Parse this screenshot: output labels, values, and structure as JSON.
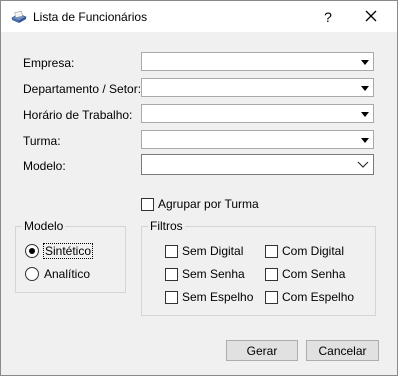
{
  "window": {
    "title": "Lista de Funcionários",
    "help_glyph": "?",
    "close_icon": "close-icon",
    "app_icon": "report-icon"
  },
  "fields": {
    "empresa": {
      "label": "Empresa:",
      "value": ""
    },
    "departamento": {
      "label": "Departamento / Setor:",
      "value": ""
    },
    "horario": {
      "label": "Horário de Trabalho:",
      "value": ""
    },
    "turma": {
      "label": "Turma:",
      "value": ""
    },
    "modelo": {
      "label": "Modelo:",
      "value": ""
    }
  },
  "agrupar": {
    "label": "Agrupar por Turma",
    "checked": false
  },
  "modelo_group": {
    "title": "Modelo",
    "options": [
      {
        "label": "Sintético",
        "selected": true
      },
      {
        "label": "Analítico",
        "selected": false
      }
    ]
  },
  "filtros": {
    "title": "Filtros",
    "sem_digital": "Sem Digital",
    "com_digital": "Com Digital",
    "sem_senha": "Sem Senha",
    "com_senha": "Com Senha",
    "sem_espelho": "Sem Espelho",
    "com_espelho": "Com Espelho"
  },
  "buttons": {
    "gerar": "Gerar",
    "cancelar": "Cancelar"
  }
}
